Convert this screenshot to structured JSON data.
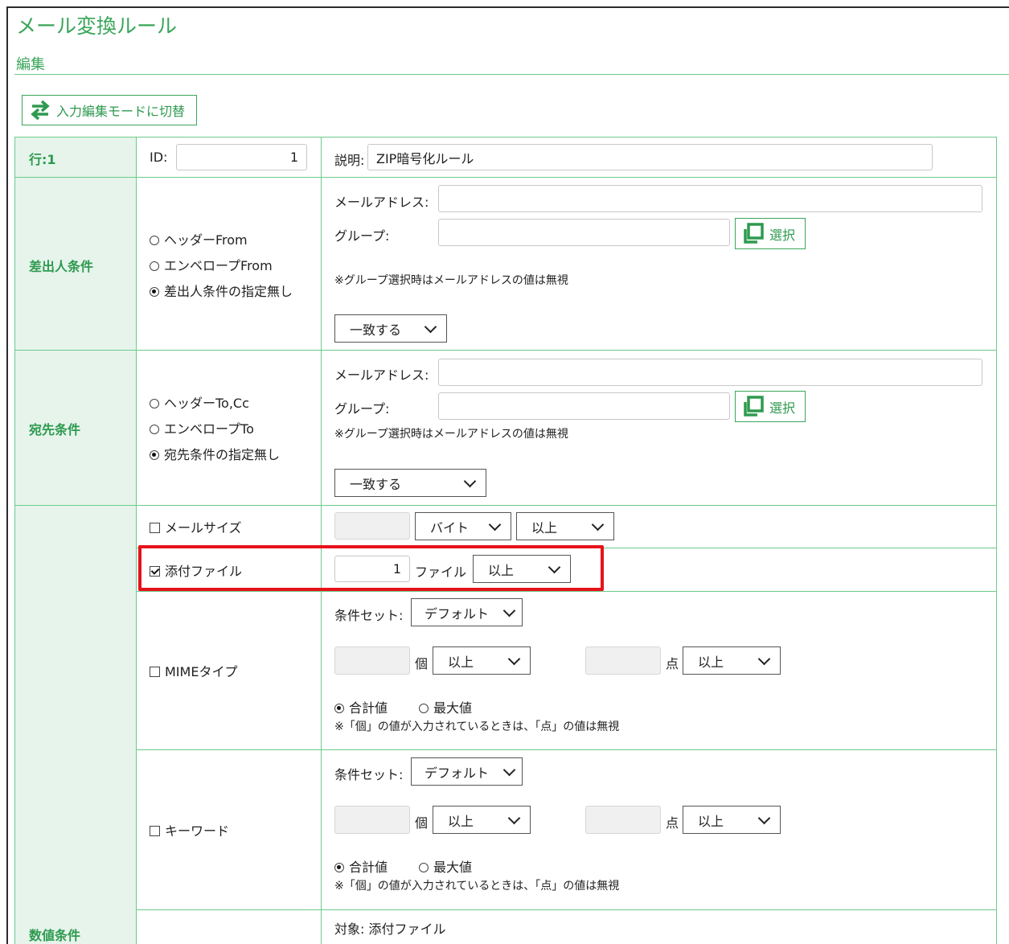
{
  "page": {
    "title": "メール変換ルール",
    "subtitle": "編集",
    "mode_button": "入力編集モードに切替"
  },
  "row_header": {
    "row_label": "行:1",
    "id_label": "ID:",
    "id_value": "1",
    "desc_label": "説明:",
    "desc_value": "ZIP暗号化ルール"
  },
  "sender": {
    "label": "差出人条件",
    "options": [
      "ヘッダーFrom",
      "エンベロープFrom",
      "差出人条件の指定無し"
    ],
    "selected": 2,
    "mail_label": "メールアドレス:",
    "mail_value": "",
    "group_label": "グループ:",
    "group_value": "",
    "pick_label": "選択",
    "note": "※グループ選択時はメールアドレスの値は無視",
    "match_value": "一致する"
  },
  "recipient": {
    "label": "宛先条件",
    "options": [
      "ヘッダーTo,Cc",
      "エンベロープTo",
      "宛先条件の指定無し"
    ],
    "selected": 2,
    "mail_label": "メールアドレス:",
    "mail_value": "",
    "group_label": "グループ:",
    "group_value": "",
    "pick_label": "選択",
    "note": "※グループ選択時はメールアドレスの値は無視",
    "match_value": "一致する"
  },
  "numeric": {
    "label": "数値条件",
    "mail_size": {
      "label": "メールサイズ",
      "checked": false,
      "value": "",
      "unit": "バイト",
      "cmp": "以上"
    },
    "attachment": {
      "label": "添付ファイル",
      "checked": true,
      "value": "1",
      "unit": "ファイル",
      "cmp": "以上"
    },
    "mime": {
      "label": "MIMEタイプ",
      "checked": false,
      "set_label": "条件セット:",
      "set_value": "デフォルト",
      "count_value": "",
      "count_unit": "個",
      "count_cmp": "以上",
      "point_value": "",
      "point_unit": "点",
      "point_cmp": "以上",
      "radio_total": "合計値",
      "radio_max": "最大値",
      "note": "※「個」の値が入力されているときは、「点」の値は無視"
    },
    "keyword": {
      "label": "キーワード",
      "checked": false,
      "set_label": "条件セット:",
      "set_value": "デフォルト",
      "count_value": "",
      "count_unit": "個",
      "count_cmp": "以上",
      "point_value": "",
      "point_unit": "点",
      "point_cmp": "以上",
      "radio_total": "合計値",
      "radio_max": "最大値",
      "note": "※「個」の値が入力されているときは、「点」の値は無視"
    },
    "target_label": "対象: 添付ファイル"
  },
  "colors": {
    "accent": "#3aa55a",
    "highlight": "#e8121b",
    "label_bg": "#e6f4ec"
  }
}
